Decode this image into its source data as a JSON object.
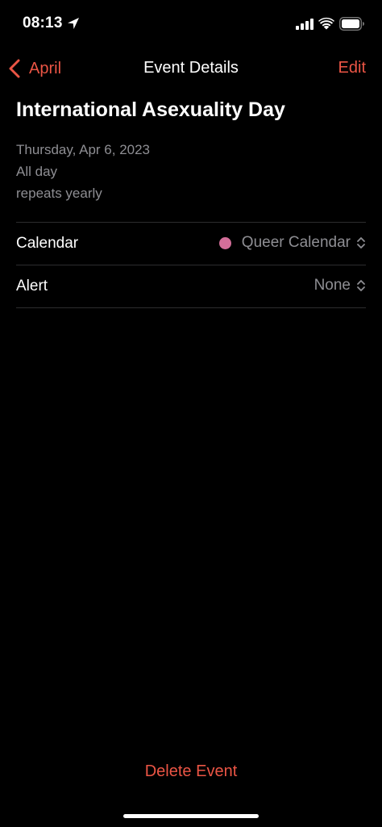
{
  "status_bar": {
    "time": "08:13",
    "icons": [
      "location-arrow-icon",
      "cellular-signal-icon",
      "wifi-icon",
      "battery-icon"
    ]
  },
  "nav": {
    "back_label": "April",
    "title": "Event Details",
    "edit_label": "Edit"
  },
  "event": {
    "title": "International Asexuality Day",
    "date": "Thursday, Apr 6, 2023",
    "all_day": "All day",
    "repeat": "repeats yearly"
  },
  "rows": {
    "calendar": {
      "label": "Calendar",
      "value": "Queer Calendar",
      "dot_color": "#d36e99"
    },
    "alert": {
      "label": "Alert",
      "value": "None"
    }
  },
  "actions": {
    "delete_label": "Delete Event"
  },
  "colors": {
    "accent": "#eb5545",
    "secondary_text": "#8e8e93",
    "background": "#000000"
  }
}
